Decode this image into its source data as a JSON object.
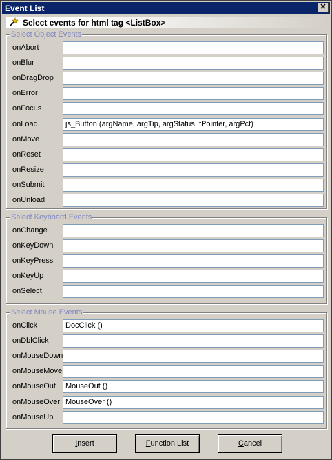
{
  "window": {
    "title": "Event List",
    "close_glyph": "✕"
  },
  "banner": {
    "text": "Select events for html tag <ListBox>",
    "icon": "wand-icon"
  },
  "groups": {
    "object": {
      "legend": "Select Object Events",
      "rows": [
        {
          "label": "onAbort",
          "value": ""
        },
        {
          "label": "onBlur",
          "value": ""
        },
        {
          "label": "onDragDrop",
          "value": ""
        },
        {
          "label": "onError",
          "value": ""
        },
        {
          "label": "onFocus",
          "value": ""
        },
        {
          "label": "onLoad",
          "value": "js_Button (argName, argTip, argStatus, fPointer, argPct)"
        },
        {
          "label": "onMove",
          "value": ""
        },
        {
          "label": "onReset",
          "value": ""
        },
        {
          "label": "onResize",
          "value": ""
        },
        {
          "label": "onSubmit",
          "value": ""
        },
        {
          "label": "onUnload",
          "value": ""
        }
      ]
    },
    "keyboard": {
      "legend": "Select Keyboard Events",
      "rows": [
        {
          "label": "onChange",
          "value": ""
        },
        {
          "label": "onKeyDown",
          "value": ""
        },
        {
          "label": "onKeyPress",
          "value": ""
        },
        {
          "label": "onKeyUp",
          "value": ""
        },
        {
          "label": "onSelect",
          "value": ""
        }
      ]
    },
    "mouse": {
      "legend": "Select Mouse Events",
      "rows": [
        {
          "label": "onClick",
          "value": "DocClick ()"
        },
        {
          "label": "onDblClick",
          "value": ""
        },
        {
          "label": "onMouseDown",
          "value": ""
        },
        {
          "label": "onMouseMove",
          "value": ""
        },
        {
          "label": "onMouseOut",
          "value": "MouseOut ()"
        },
        {
          "label": "onMouseOver",
          "value": "MouseOver ()"
        },
        {
          "label": "onMouseUp",
          "value": ""
        }
      ]
    }
  },
  "buttons": {
    "insert": {
      "label_pre": "",
      "label_u": "I",
      "label_post": "nsert"
    },
    "function_list": {
      "label_pre": "",
      "label_u": "F",
      "label_post": "unction List"
    },
    "cancel": {
      "label_pre": "",
      "label_u": "C",
      "label_post": "ancel"
    }
  },
  "colors": {
    "titlebar": "#0a246a",
    "legend": "#7f86c4",
    "field_border": "#7f9db9"
  }
}
